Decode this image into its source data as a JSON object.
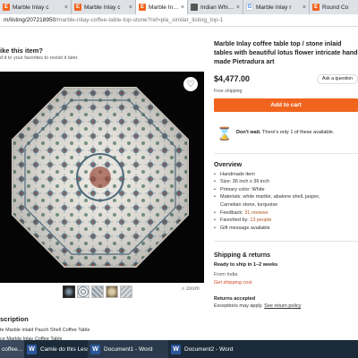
{
  "browser": {
    "tabs": [
      {
        "icon": "etsy",
        "title": "Marble Inlay c"
      },
      {
        "icon": "etsy",
        "title": "Marble Inlay c"
      },
      {
        "icon": "etsy",
        "title": "Marble Inlay c"
      },
      {
        "icon": "generic",
        "title": "Indian White n"
      },
      {
        "icon": "google",
        "title": "Marble Inlay r"
      },
      {
        "icon": "etsy",
        "title": "Round Co"
      }
    ],
    "url_host": "m/listing/207218950",
    "url_path": "/marble-inlay-coffee-table-top-stone?ref=pla_similar_listing_top-1"
  },
  "left": {
    "save_title": "ike this item?",
    "save_hint": "d it to your favorites to revisit it later.",
    "zoom_label": "zoom",
    "description_heading": "scription",
    "description_line1": "te Marble inlaid Pauch Shell Coffee Table",
    "description_line2": "ce Marble Inlay Coffee Table"
  },
  "listing": {
    "title": "Marble Inlay coffee table top / stone inlaid tables with beautiful lotus flower intricate hand made Pietradura art",
    "price": "$4,477.00",
    "ask_question": "Ask a question",
    "shipping_note": "Free shipping",
    "add_to_cart": "Add to cart",
    "scarcity_bold": "Don't wait.",
    "scarcity_text": " There's only 1 of these available."
  },
  "overview": {
    "heading": "Overview",
    "items": [
      {
        "text": "Handmade item"
      },
      {
        "text": "Size: 36 inch x 36 inch"
      },
      {
        "text": "Primary color: White"
      },
      {
        "text": "Materials: white marble, abalone shell, jasper,"
      },
      {
        "text": "Carnelian stone, turquoise",
        "continuation": true
      },
      {
        "text": "Feedback: ",
        "link": "31 reviews"
      },
      {
        "text": "Favorited by: ",
        "link": "13 people"
      },
      {
        "text": "Gift message available"
      }
    ]
  },
  "shipping": {
    "heading": "Shipping & returns",
    "ready": "Ready to ship in 1–2 weeks",
    "from_label": "From India",
    "from_value": "",
    "cost": "Get shipping cost",
    "returns_heading": "Returns accepted",
    "returns_text": "Exceptions may apply.",
    "returns_link": "See return policy"
  },
  "taskbar": {
    "items": [
      {
        "label": "coffee..."
      },
      {
        "label": "Camie do this Lesso..."
      },
      {
        "label": "Document1 - Word"
      },
      {
        "label": "Document2 - Word"
      }
    ]
  },
  "colors": {
    "accent": "#f1641e",
    "link": "#b0541f",
    "shipping_cost": "#d0472b",
    "taskbar": "#1c2b3a"
  }
}
